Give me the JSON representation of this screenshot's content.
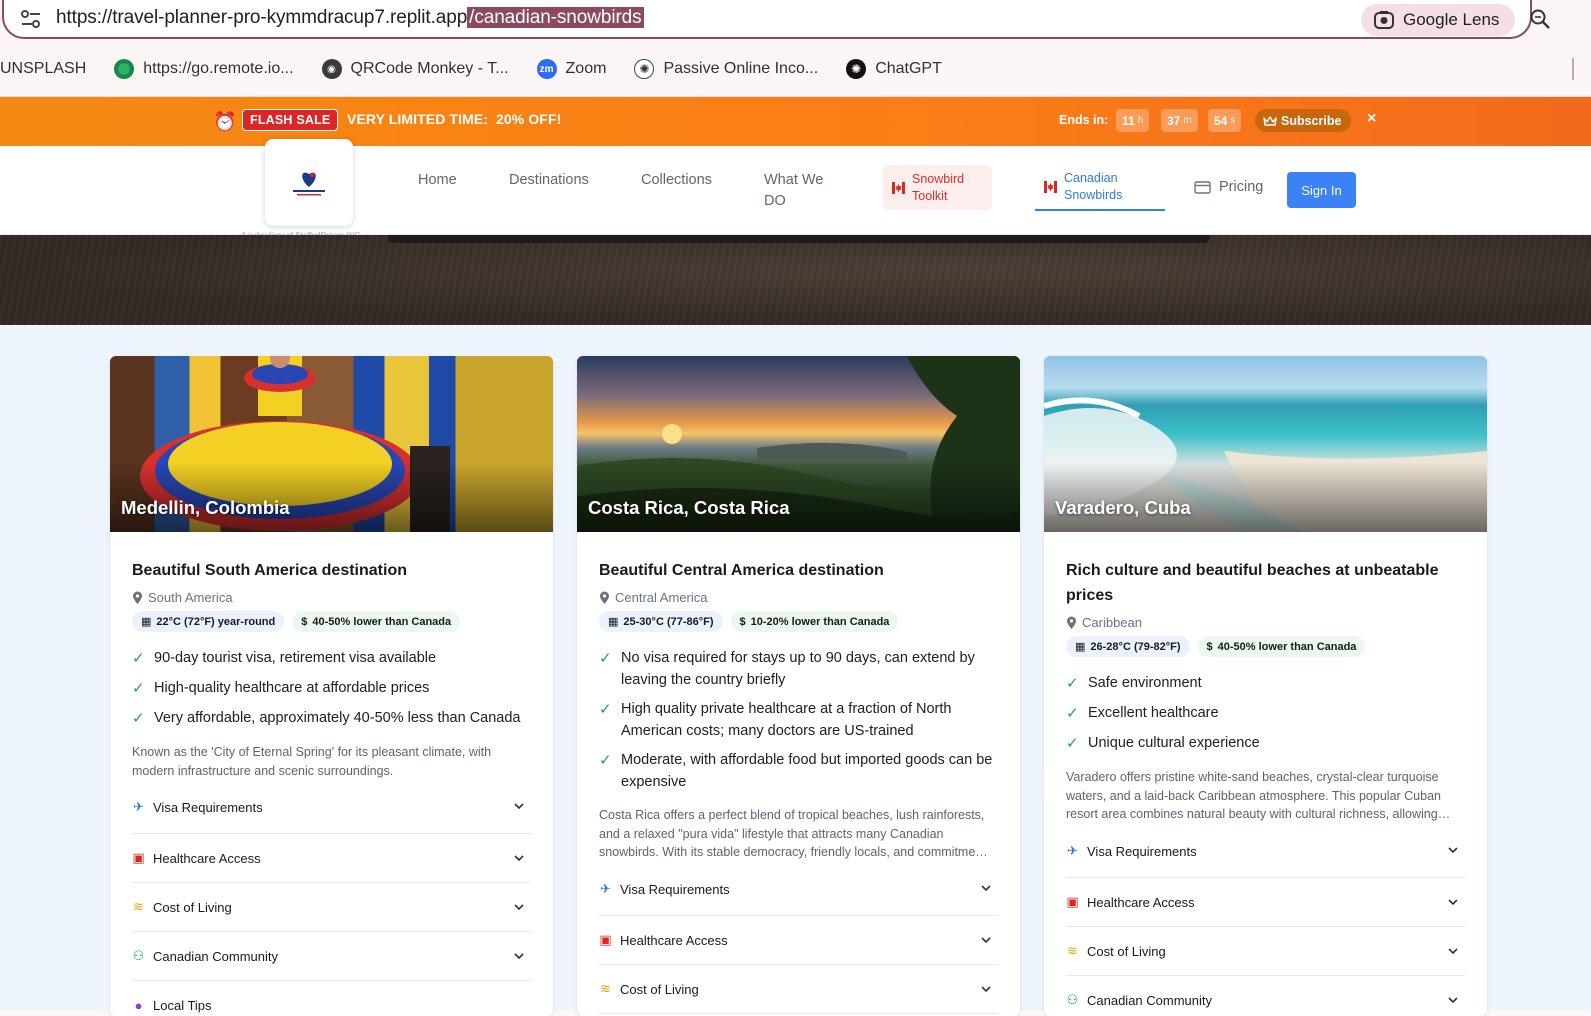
{
  "browser": {
    "url_base": "https://travel-planner-pro-kymmdracup7.replit.app",
    "url_path": "/canadian-snowbirds",
    "lens_label": "Google Lens",
    "bookmarks": [
      "UNSPLASH",
      "https://go.remote.io...",
      "QRCode Monkey - T...",
      "Zoom",
      "Passive Online Inco...",
      "ChatGPT"
    ]
  },
  "flash": {
    "badge": "FLASH SALE",
    "offer": "VERY LIMITED TIME:  20% OFF!",
    "ends_label": "Ends in:",
    "hours": "11",
    "hours_unit": "h",
    "minutes": "37",
    "minutes_unit": "m",
    "seconds": "54",
    "seconds_unit": "s",
    "subscribe": "Subscribe",
    "close": "×"
  },
  "nav": {
    "logo_tagline": "A subsidiary of StaffedDream INC",
    "home": "Home",
    "destinations": "Destinations",
    "collections": "Collections",
    "what_we_do_1": "What We",
    "what_we_do_2": "DO",
    "toolkit_1": "Snowbird",
    "toolkit_2": "Toolkit",
    "canadian_1": "Canadian",
    "canadian_2": "Snowbirds",
    "pricing": "Pricing",
    "signin": "Sign In"
  },
  "accordion_labels": {
    "visa": "Visa Requirements",
    "health": "Healthcare Access",
    "cost": "Cost of Living",
    "community": "Canadian Community",
    "local": "Local Tips"
  },
  "cards": [
    {
      "city": "Medellin, Colombia",
      "headline": "Beautiful South America destination",
      "region": "South America",
      "temp": "22°C (72°F) year-round",
      "cost": "40-50% lower than Canada",
      "features": [
        "90-day tourist visa, retirement visa available",
        "High-quality healthcare at affordable prices",
        "Very affordable, approximately 40-50% less than Canada"
      ],
      "description": "Known as the 'City of Eternal Spring' for its pleasant climate, with modern infrastructure and scenic surroundings."
    },
    {
      "city": "Costa Rica, Costa Rica",
      "headline": "Beautiful Central America destination",
      "region": "Central America",
      "temp": "25-30°C (77-86°F)",
      "cost": "10-20% lower than Canada",
      "features": [
        "No visa required for stays up to 90 days, can extend by leaving the country briefly",
        "High quality private healthcare at a fraction of North American costs; many doctors are US-trained",
        "Moderate, with affordable food but imported goods can be expensive"
      ],
      "description": "Costa Rica offers a perfect blend of tropical beaches, lush rainforests, and a relaxed \"pura vida\" lifestyle that attracts many Canadian snowbirds. With its stable democracy, friendly locals, and commitme…"
    },
    {
      "city": "Varadero, Cuba",
      "headline": "Rich culture and beautiful beaches at unbeatable prices",
      "region": "Caribbean",
      "temp": "26-28°C (79-82°F)",
      "cost": "40-50% lower than Canada",
      "features": [
        "Safe environment",
        "Excellent healthcare",
        "Unique cultural experience"
      ],
      "description": "Varadero offers pristine white-sand beaches, crystal-clear turquoise waters, and a laid-back Caribbean atmosphere. This popular Cuban resort area combines natural beauty with cultural richness, allowing…"
    }
  ],
  "colors": {
    "accent": "#3b82f6",
    "flash": "#f58a12",
    "check": "#1fa34a"
  }
}
